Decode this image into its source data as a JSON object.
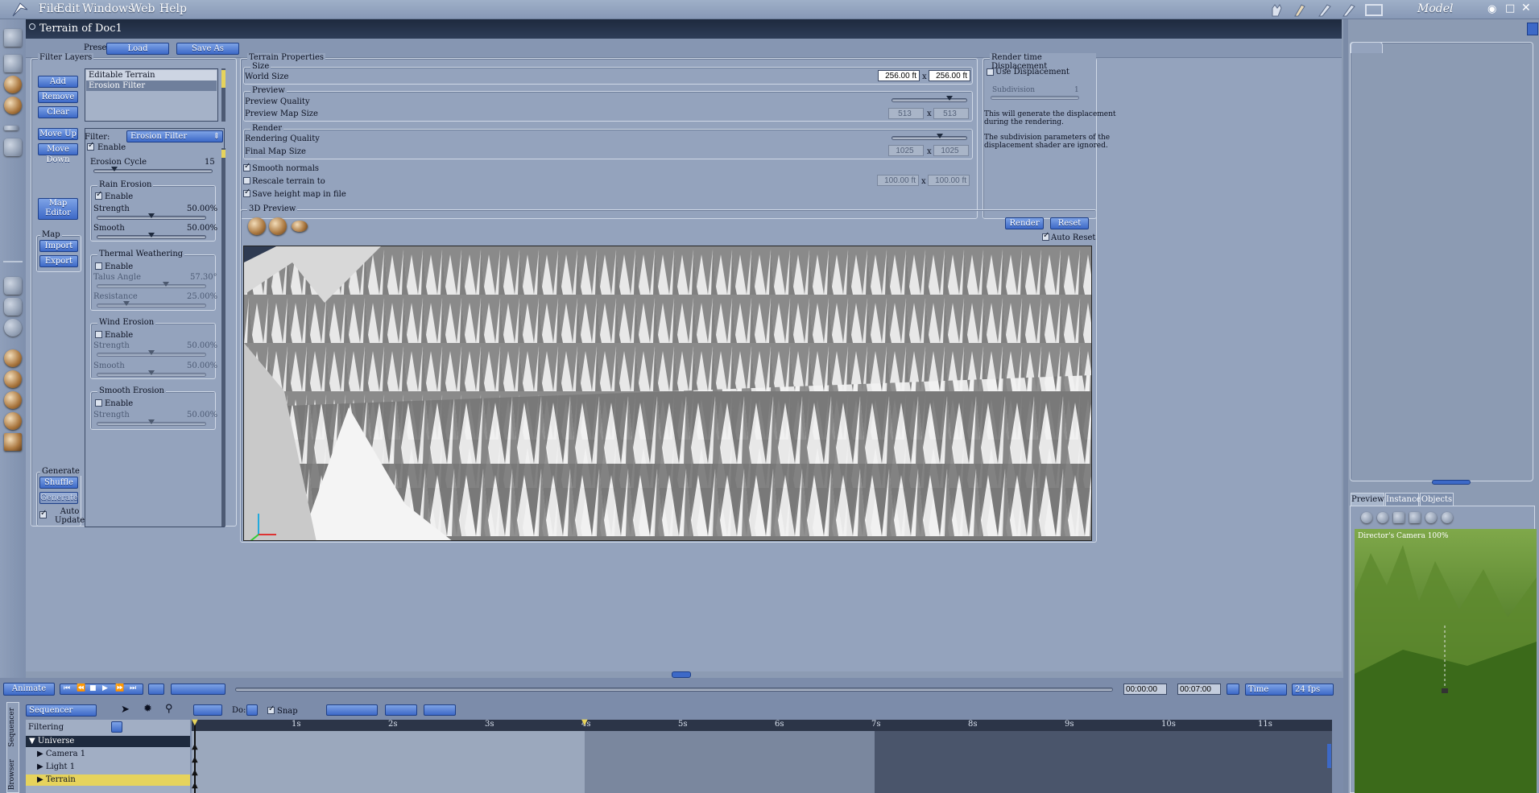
{
  "menu": {
    "file": "File",
    "edit": "Edit",
    "windows": "Windows",
    "web": "Web",
    "help": "Help",
    "mode": "Model"
  },
  "document": {
    "title": "Terrain of Doc1",
    "preset_label": "Preset:",
    "load": "Load",
    "save_as": "Save As"
  },
  "filter_layers": {
    "title": "Filter Layers",
    "add": "Add",
    "remove": "Remove",
    "clear": "Clear",
    "move_up": "Move Up",
    "move_down": "Move Down",
    "map_editor_1": "Map",
    "map_editor_2": "Editor",
    "layers": [
      "Editable Terrain",
      "Erosion Filter"
    ],
    "map_group": "Map",
    "import": "Import",
    "export": "Export",
    "generate_group": "Generate",
    "shuffle": "Shuffle",
    "generate": "Generate",
    "auto_update_1": "Auto",
    "auto_update_2": "Update"
  },
  "filter": {
    "label": "Filter:",
    "selected": "Erosion Filter",
    "enable": "Enable",
    "erosion_cycle_label": "Erosion Cycle",
    "erosion_cycle_value": "15",
    "erosion_cycle_fraction": 0.15,
    "rain": {
      "title": "Rain Erosion",
      "enable": "Enable",
      "strength_label": "Strength",
      "strength_value": "50.00%",
      "strength": 0.5,
      "smooth_label": "Smooth",
      "smooth_value": "50.00%",
      "smooth": 0.5
    },
    "thermal": {
      "title": "Thermal Weathering",
      "enable": "Enable",
      "talus_label": "Talus Angle",
      "talus_value": "57.30°",
      "talus": 0.64,
      "resistance_label": "Resistance",
      "resistance_value": "25.00%",
      "resistance": 0.25
    },
    "wind": {
      "title": "Wind Erosion",
      "enable": "Enable",
      "strength_label": "Strength",
      "strength_value": "50.00%",
      "strength": 0.5,
      "smooth_label": "Smooth",
      "smooth_value": "50.00%",
      "smooth": 0.5
    },
    "smooth_erosion": {
      "title": "Smooth Erosion",
      "enable": "Enable",
      "strength_label": "Strength",
      "strength_value": "50.00%",
      "strength": 0.5
    }
  },
  "terrain": {
    "title": "Terrain Properties",
    "size_group": "Size",
    "world_size": "World Size",
    "world_x": "256.00 ft",
    "world_y": "256.00 ft",
    "x": "x",
    "preview_group": "Preview",
    "preview_quality": "Preview Quality",
    "preview_quality_level": 0.8,
    "preview_map_size": "Preview Map Size",
    "preview_x": "513",
    "preview_y": "513",
    "render_group": "Render",
    "rendering_quality": "Rendering Quality",
    "rendering_quality_level": 0.65,
    "final_map_size": "Final Map Size",
    "final_x": "1025",
    "final_y": "1025",
    "smooth_normals": "Smooth normals",
    "rescale": "Rescale terrain to",
    "rescale_x": "100.00 ft",
    "rescale_y": "100.00 ft",
    "save_height": "Save height map in file"
  },
  "displacement": {
    "title": "Render time Displacement",
    "use": "Use Displacement",
    "subdivision": "Subdivision",
    "subdivision_value": "1",
    "note1a": "This will generate the displacement",
    "note1b": "during the rendering.",
    "note2a": "The subdivision parameters of the",
    "note2b": "displacement shader are ignored."
  },
  "preview3d": {
    "title": "3D Preview",
    "render": "Render",
    "reset": "Reset",
    "auto_reset": "Auto Reset"
  },
  "timeline": {
    "animate": "Animate",
    "time_start": "00:00:00",
    "time_end": "00:07:00",
    "time_mode": "Time",
    "fps": "24 fps",
    "sequencer": "Sequencer",
    "do_label": "Do:",
    "snap": "Snap",
    "filtering": "Filtering",
    "ticks": [
      "1s",
      "2s",
      "3s",
      "4s",
      "5s",
      "6s",
      "7s",
      "8s",
      "9s",
      "10s",
      "11s"
    ],
    "tracks": [
      "Universe",
      "Camera 1",
      "Light 1",
      "Terrain"
    ],
    "side_tab_1": "Sequencer",
    "side_tab_2": "Browser"
  },
  "right": {
    "tab_preview": "Preview",
    "tab_instances": "Instances",
    "tab_objects": "Objects",
    "camera_label": "Director's Camera 100%"
  }
}
